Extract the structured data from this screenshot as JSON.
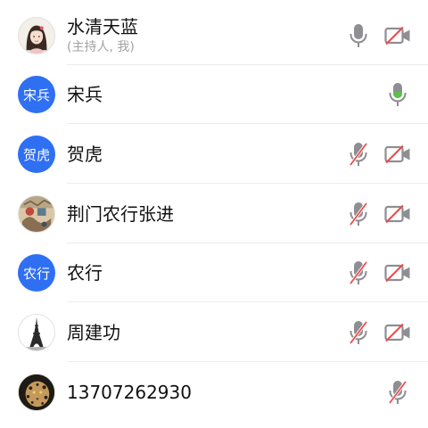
{
  "participants": [
    {
      "name": "水清天蓝",
      "subtitle": "(主持人, 我)",
      "avatar_type": "image",
      "avatar_icon": "portrait-girl-avatar",
      "mic": "off-gray",
      "camera": "off"
    },
    {
      "name": "宋兵",
      "avatar_text": "宋兵",
      "avatar_type": "text",
      "mic": "on-active",
      "camera": "none"
    },
    {
      "name": "贺虎",
      "avatar_text": "贺虎",
      "avatar_type": "text",
      "mic": "muted",
      "camera": "off"
    },
    {
      "name": "荆门农行张进",
      "avatar_type": "image",
      "avatar_icon": "painting-avatar",
      "mic": "muted",
      "camera": "off"
    },
    {
      "name": "农行",
      "avatar_text": "农行",
      "avatar_type": "text",
      "mic": "muted",
      "camera": "off"
    },
    {
      "name": "周建功",
      "avatar_type": "image",
      "avatar_icon": "eiffel-tower-avatar",
      "mic": "muted",
      "camera": "off"
    },
    {
      "name": "13707262930",
      "avatar_type": "image",
      "avatar_icon": "leopard-avatar",
      "mic": "muted",
      "camera": "none"
    }
  ],
  "colors": {
    "avatar_blue": "#2f6ff2",
    "icon_gray": "#8e8e93",
    "mute_red": "#ec4b4b",
    "active_green": "#5cc04b",
    "divider": "#ececec"
  }
}
